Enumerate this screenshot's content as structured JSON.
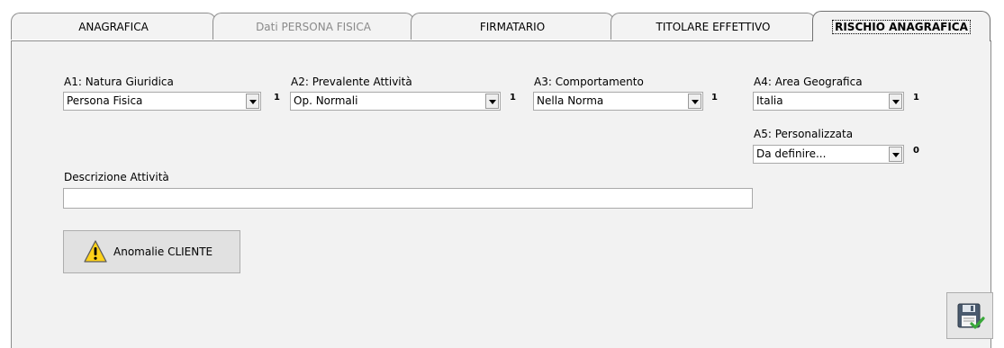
{
  "tabs": [
    {
      "label": "ANAGRAFICA"
    },
    {
      "label": "Dati PERSONA FISICA"
    },
    {
      "label": "FIRMATARIO"
    },
    {
      "label": "TITOLARE EFFETTIVO"
    },
    {
      "label": "RISCHIO ANAGRAFICA"
    }
  ],
  "fields": {
    "a1": {
      "label": "A1: Natura Giuridica",
      "value": "Persona Fisica",
      "score": "1"
    },
    "a2": {
      "label": "A2: Prevalente Attività",
      "value": "Op. Normali",
      "score": "1"
    },
    "a3": {
      "label": "A3: Comportamento",
      "value": "Nella Norma",
      "score": "1"
    },
    "a4": {
      "label": "A4: Area Geografica",
      "value": "Italia",
      "score": "1"
    },
    "a5": {
      "label": "A5: Personalizzata",
      "value": "Da definire...",
      "score": "0"
    }
  },
  "descrizione": {
    "label": "Descrizione Attività",
    "value": ""
  },
  "anomalie_button": {
    "label": "Anomalie CLIENTE",
    "icon": "warning-icon"
  },
  "save_button": {
    "icon": "save-icon"
  },
  "colors": {
    "warning_fill": "#ffd21a",
    "save_green": "#3aa83a"
  }
}
